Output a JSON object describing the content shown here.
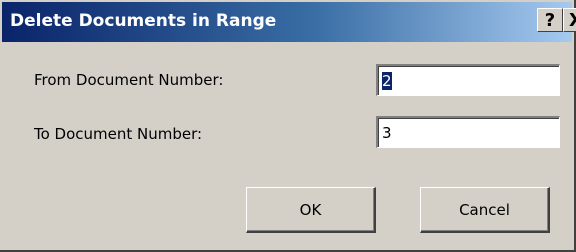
{
  "window": {
    "title": "Delete Documents in Range",
    "help_button": "?",
    "close_button": "X"
  },
  "form": {
    "from_label": "From Document Number:",
    "from_value": "2",
    "to_label": "To Document Number:",
    "to_value": "3"
  },
  "buttons": {
    "ok": "OK",
    "cancel": "Cancel"
  },
  "colors": {
    "titlebar_start": "#0a246a",
    "titlebar_end": "#a6caf0",
    "dialog_face": "#d4d0c8",
    "selection": "#0a246a"
  },
  "icons": {
    "help": "help-icon",
    "close": "close-icon"
  }
}
